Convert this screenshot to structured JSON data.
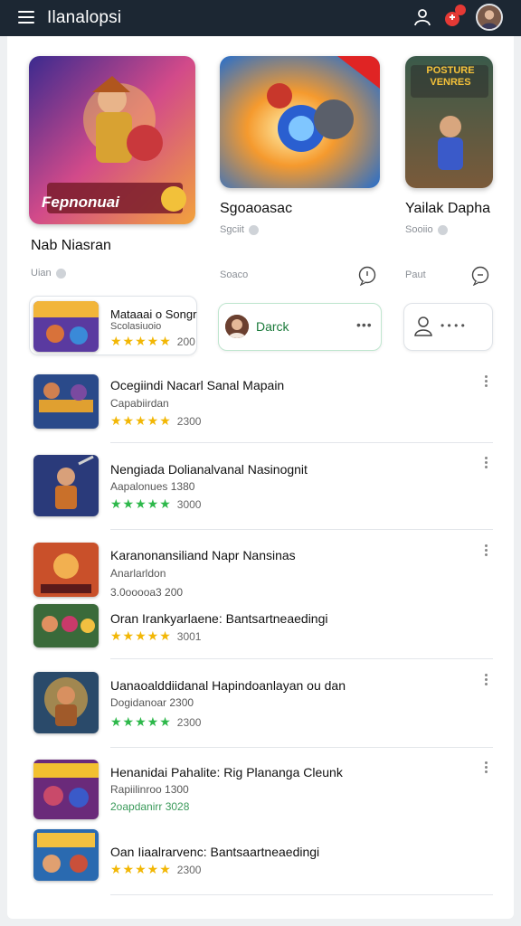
{
  "app": {
    "title": "Ilanalopsi",
    "notification_count": ""
  },
  "featured": [
    {
      "title": "Nab Niasran",
      "subtitle": "Uian",
      "banner": "Fepnonuai"
    },
    {
      "title": "Sgoaoasac",
      "subtitle": "Sgciit",
      "meta": "Soaco"
    },
    {
      "title": "Yailak Dapha",
      "subtitle": "Sooiio",
      "meta": "Paut",
      "banner": "POSTURE VENRES"
    }
  ],
  "mini": {
    "game": {
      "title": "Mataaai o Songr",
      "sub": "Scolasiuoio",
      "stars": "★★★★★",
      "rating": "200"
    },
    "chat": {
      "name": "Darck",
      "more": "•••"
    },
    "contact": {
      "more": "• • • •"
    }
  },
  "list": [
    {
      "title": "Ocegiindi Nacarl Sanal Mapain",
      "sub": "Capabiirdan",
      "stars": "★★★★★",
      "rating": "2300",
      "color": "gold"
    },
    {
      "title": "Nengiada Dolianalvanal Nasinognit",
      "sub": "Aapalonues 1380",
      "stars": "★★★★★",
      "rating": "3000",
      "color": "green"
    },
    {
      "title": "Karanonansiliand Napr Nansinas",
      "sub": "Anarlarldon",
      "stars": "",
      "rating": "3.0ooooa3 200",
      "color": "green",
      "extra": {
        "title": "Oran Irankyarlaene: Bantsartneaedingi",
        "stars": "★★★★★",
        "rating": "3001"
      }
    },
    {
      "title": "Uanaoalddiidanal Hapindoanlayan ou dan",
      "sub": "Dogidanoar 2300",
      "stars": "★★★★★",
      "rating": "2300",
      "color": "green"
    },
    {
      "title": "Henanidai Pahalite: Rig Plananga Cleunk",
      "sub": "Rapiilinroo 1300",
      "stars": "",
      "rating": "2oapdanirr 3028",
      "color": "green",
      "extra": {
        "title": "Oan Iiaalrarvenc: Bantsaartneaedingi",
        "stars": "★★★★★",
        "rating": "2300"
      }
    }
  ]
}
